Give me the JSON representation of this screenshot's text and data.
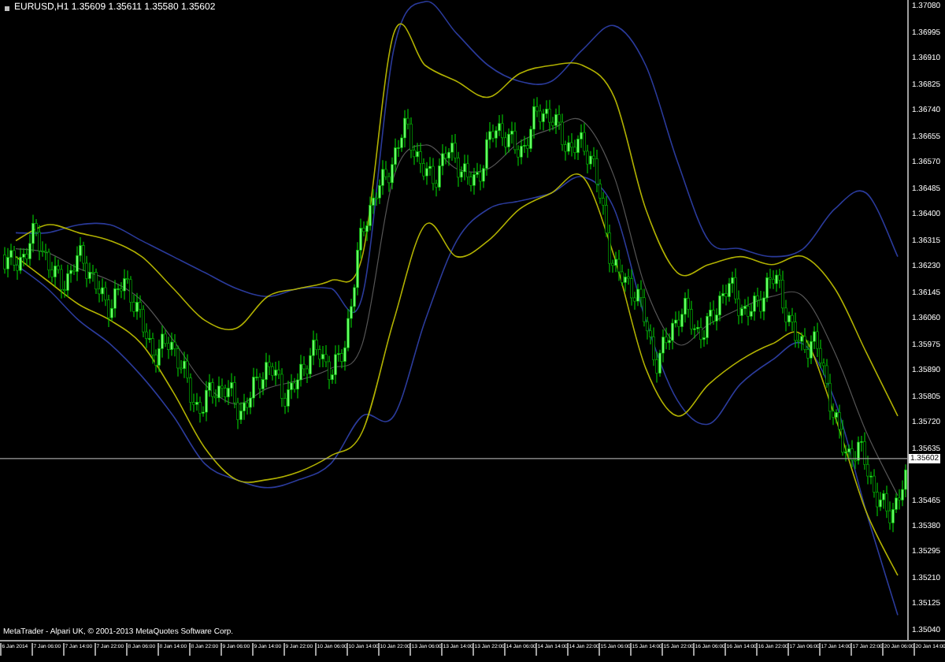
{
  "chart": {
    "header": "EURUSD,H1  1.35609 1.35611 1.35580 1.35602",
    "copyright": "MetaTrader - Alpari UK, © 2001-2013 MetaQuotes Software Corp.",
    "current_price": "1.35602",
    "chart_data": {
      "type": "line",
      "ylim": [
        1.35009,
        1.37101
      ],
      "categories": [
        "6 Jan 2014",
        "7 Jan 06:00",
        "7 Jan 14:00",
        "7 Jan 22:00",
        "8 Jan 06:00",
        "8 Jan 14:00",
        "8 Jan 22:00",
        "9 Jan 06:00",
        "9 Jan 14:00",
        "9 Jan 22:00",
        "10 Jan 06:00",
        "10 Jan 14:00",
        "10 Jan 22:00",
        "13 Jan 06:00",
        "13 Jan 14:00",
        "13 Jan 22:00",
        "14 Jan 06:00",
        "14 Jan 14:00",
        "14 Jan 22:00",
        "15 Jan 06:00",
        "15 Jan 14:00",
        "15 Jan 22:00",
        "16 Jan 06:00",
        "16 Jan 14:00",
        "16 Jan 22:00",
        "17 Jan 06:00",
        "17 Jan 14:00",
        "17 Jan 22:00",
        "20 Jan 06:00",
        "20 Jan 14:00"
      ],
      "yticks": [
        {
          "value": 1.3708,
          "label": "1.37080"
        },
        {
          "value": 1.36995,
          "label": "1.36995"
        },
        {
          "value": 1.3691,
          "label": "1.36910"
        },
        {
          "value": 1.36825,
          "label": "1.36825"
        },
        {
          "value": 1.3674,
          "label": "1.36740"
        },
        {
          "value": 1.36655,
          "label": "1.36655"
        },
        {
          "value": 1.3657,
          "label": "1.36570"
        },
        {
          "value": 1.36485,
          "label": "1.36485"
        },
        {
          "value": 1.364,
          "label": "1.36400"
        },
        {
          "value": 1.36315,
          "label": "1.36315"
        },
        {
          "value": 1.3623,
          "label": "1.36230"
        },
        {
          "value": 1.36145,
          "label": "1.36145"
        },
        {
          "value": 1.3606,
          "label": "1.36060"
        },
        {
          "value": 1.35975,
          "label": "1.35975"
        },
        {
          "value": 1.3589,
          "label": "1.35890"
        },
        {
          "value": 1.35805,
          "label": "1.35805"
        },
        {
          "value": 1.3572,
          "label": "1.35720"
        },
        {
          "value": 1.35635,
          "label": "1.35635"
        },
        {
          "value": 1.35465,
          "label": "1.35465"
        },
        {
          "value": 1.3538,
          "label": "1.35380"
        },
        {
          "value": 1.35295,
          "label": "1.35295"
        },
        {
          "value": 1.3521,
          "label": "1.35210"
        },
        {
          "value": 1.35125,
          "label": "1.35125"
        },
        {
          "value": 1.3504,
          "label": "1.35040"
        }
      ],
      "series": [
        {
          "color": "#2a3a9a",
          "values": [
            1.3634,
            1.3634,
            1.36366,
            1.36366,
            1.36314,
            1.36262,
            1.3621,
            1.36158,
            1.36132,
            1.36158,
            1.36158,
            1.36132,
            1.36939,
            1.37096,
            1.36991,
            1.36887,
            1.36835,
            1.36835,
            1.36939,
            1.37017,
            1.36887,
            1.36575,
            1.36314,
            1.36288,
            1.36262,
            1.36288,
            1.36418,
            1.3647,
            1.36262,
            null
          ]
        },
        {
          "color": "#2b3b9b",
          "values": [
            1.36236,
            1.36158,
            1.36054,
            1.35976,
            1.35871,
            1.35741,
            1.35585,
            1.35533,
            1.35507,
            1.35533,
            1.35585,
            1.35741,
            1.35741,
            1.36054,
            1.36314,
            1.36418,
            1.36444,
            1.3647,
            1.36523,
            1.36418,
            1.36054,
            1.35793,
            1.35715,
            1.35845,
            1.35923,
            1.35976,
            1.35793,
            1.35428,
            1.3509,
            null
          ]
        },
        {
          "color": "#b0b000",
          "values": [
            1.36314,
            1.36366,
            1.3634,
            1.36314,
            1.36262,
            1.36158,
            1.36054,
            1.36028,
            1.36132,
            1.36158,
            1.36184,
            1.36262,
            1.36991,
            1.36887,
            1.36835,
            1.36783,
            1.36861,
            1.36887,
            1.36887,
            1.36783,
            1.36418,
            1.3621,
            1.36236,
            1.36262,
            1.36236,
            1.36262,
            1.36158,
            1.35949,
            1.35741,
            null
          ]
        },
        {
          "color": "#b1b101",
          "values": [
            1.36262,
            1.36184,
            1.36106,
            1.36054,
            1.35976,
            1.35819,
            1.35637,
            1.35533,
            1.35533,
            1.35559,
            1.35611,
            1.35689,
            1.36054,
            1.36366,
            1.36262,
            1.36314,
            1.36418,
            1.3647,
            1.36523,
            1.36262,
            1.35897,
            1.35741,
            1.35845,
            1.35923,
            1.35976,
            1.36002,
            1.35741,
            1.35428,
            1.3522,
            null
          ]
        },
        {
          "color": "#555555",
          "values": [
            1.36288,
            1.36275,
            1.36223,
            1.36184,
            1.36119,
            1.35989,
            1.35845,
            1.3578,
            1.35832,
            1.35858,
            1.35897,
            1.35976,
            1.36523,
            1.36627,
            1.36549,
            1.36549,
            1.36637,
            1.36679,
            1.36705,
            1.36523,
            1.36158,
            1.35976,
            1.36041,
            1.36093,
            1.36132,
            1.36132,
            1.35949,
            1.35689,
            1.35481,
            null
          ]
        }
      ]
    }
  }
}
